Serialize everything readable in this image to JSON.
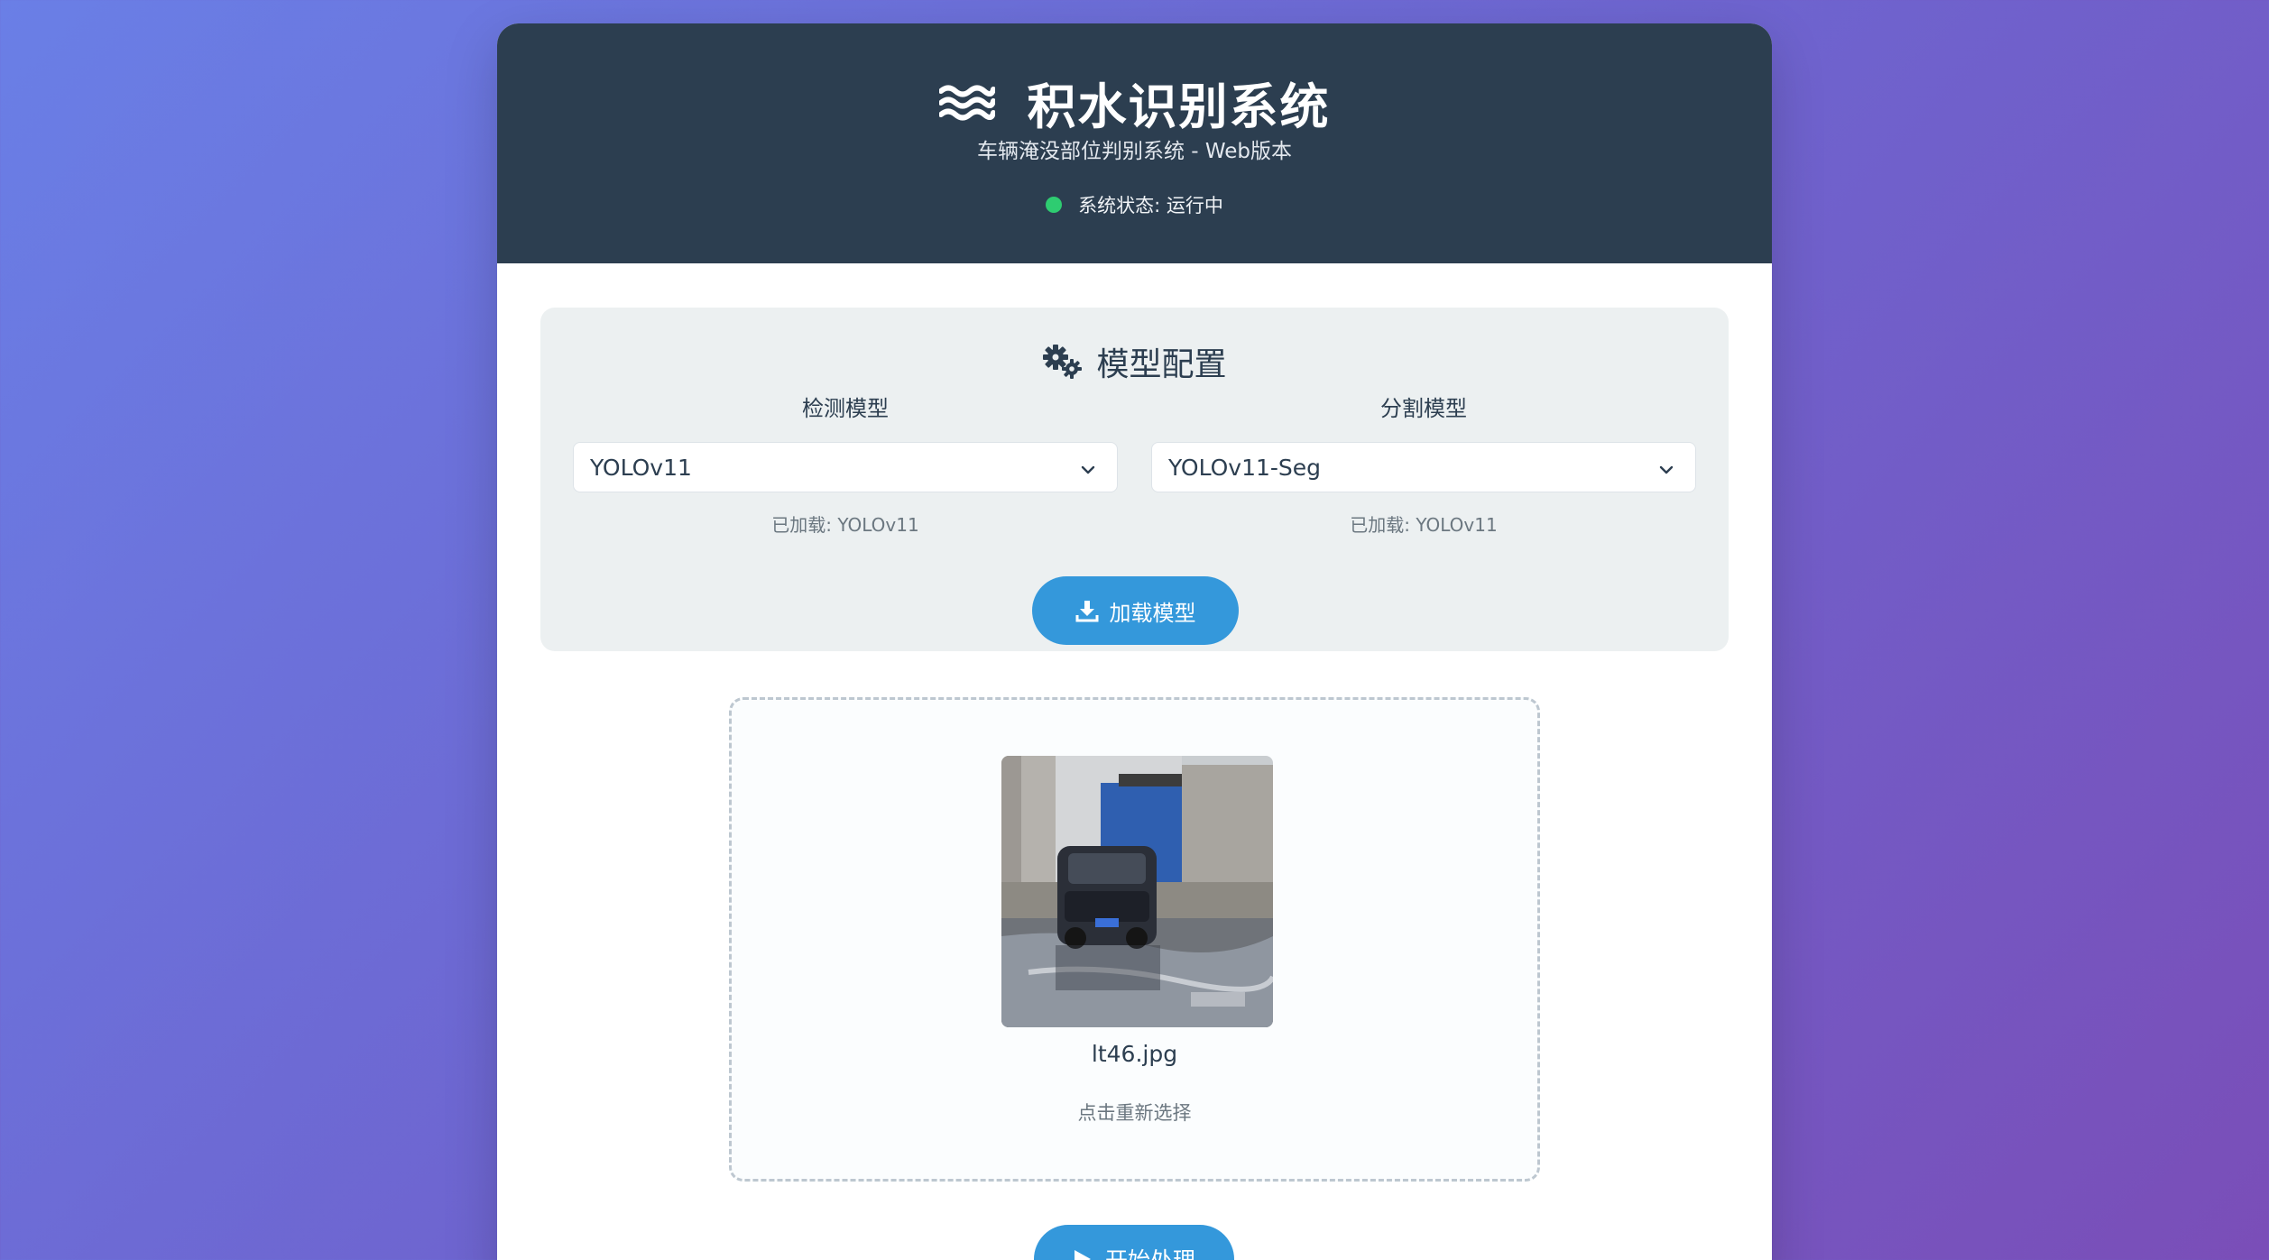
{
  "header": {
    "icon": "water-waves-icon",
    "title": "积水识别系统",
    "subtitle": "车辆淹没部位判别系统 - Web版本",
    "status_text": "系统状态: 运行中",
    "status_color": "#2ecc71"
  },
  "config": {
    "icon": "gears-icon",
    "title": "模型配置",
    "detection": {
      "label": "检测模型",
      "selected": "YOLOv11",
      "loaded_text": "已加载: YOLOv11"
    },
    "segmentation": {
      "label": "分割模型",
      "selected": "YOLOv11-Seg",
      "loaded_text": "已加载: YOLOv11"
    },
    "load_button": "加载模型"
  },
  "upload": {
    "image_alt": "flooded street with a dark minivan driving through water",
    "filename": "lt46.jpg",
    "hint": "点击重新选择"
  },
  "actions": {
    "start_button": "开始处理"
  },
  "colors": {
    "header_bg": "#2c3e50",
    "accent": "#3498db",
    "panel_bg": "#ecf0f1"
  }
}
